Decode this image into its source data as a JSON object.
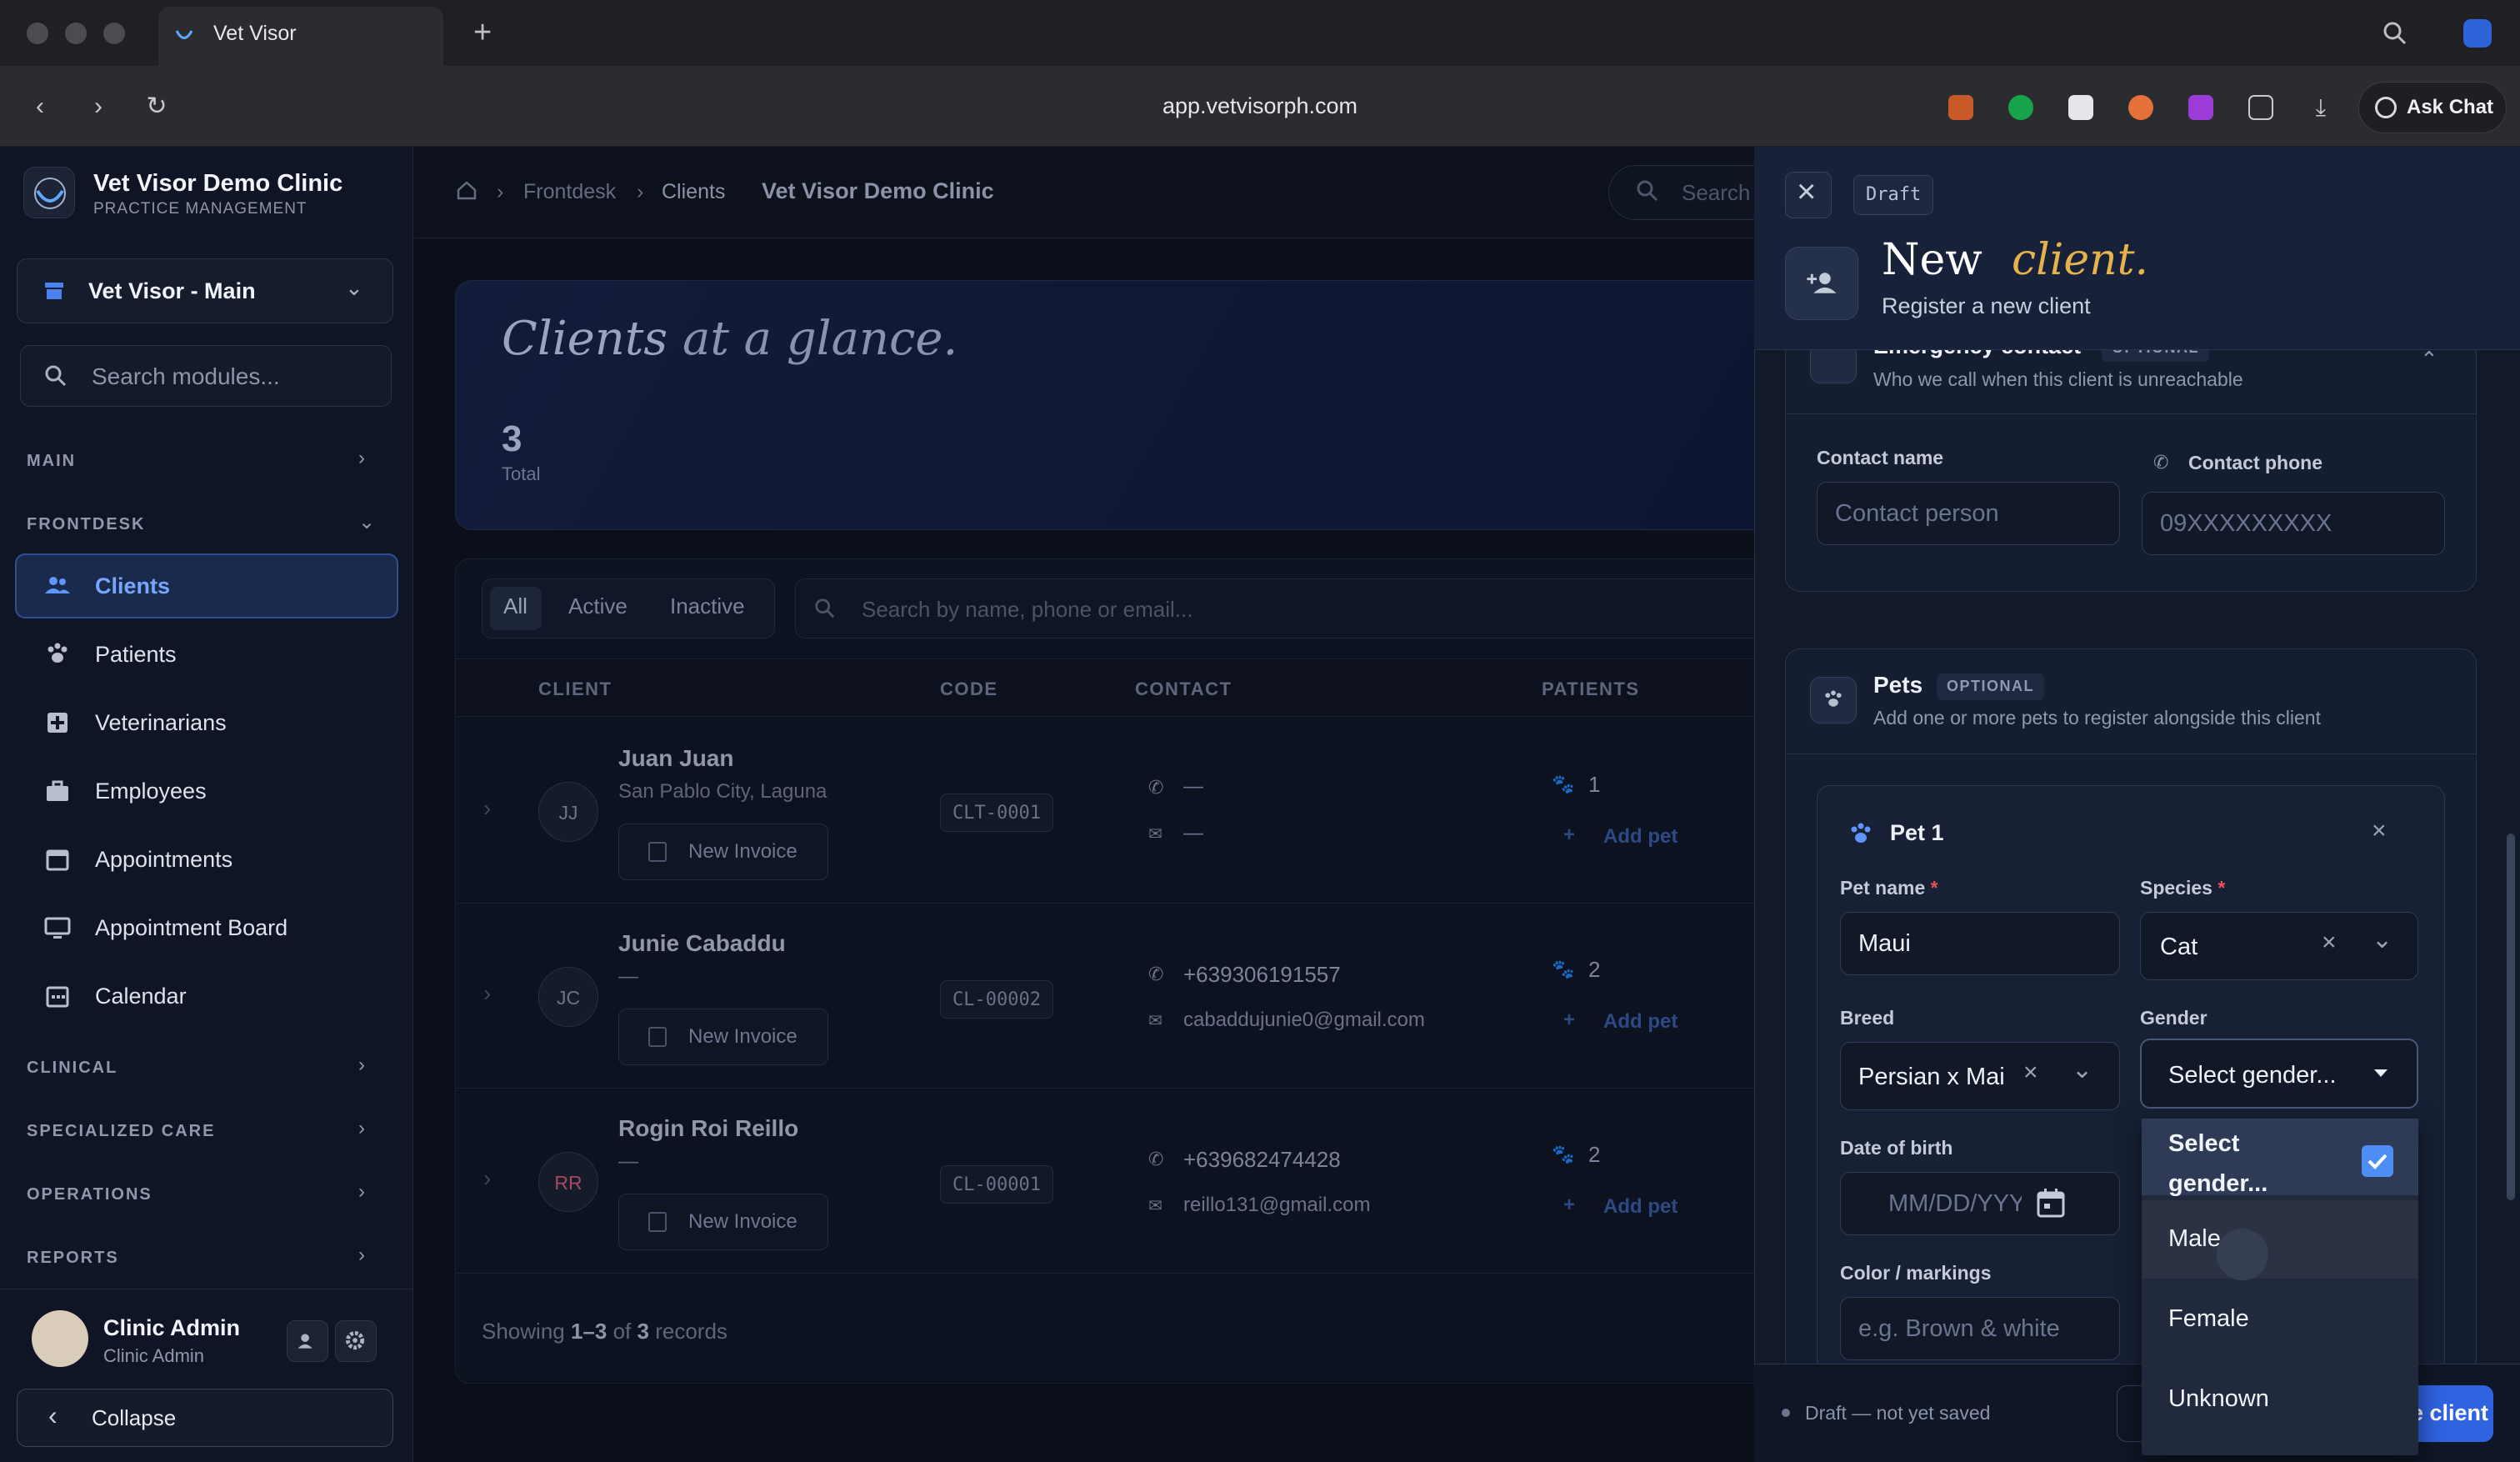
{
  "browser": {
    "tab_title": "Vet Visor",
    "url": "app.vetvisorph.com",
    "ask_chat": "Ask Chat"
  },
  "sidebar": {
    "clinic_name": "Vet Visor Demo Clinic",
    "clinic_sub": "PRACTICE MANAGEMENT",
    "branch": "Vet Visor - Main",
    "search_placeholder": "Search modules...",
    "sections": {
      "main": "MAIN",
      "frontdesk": "FRONTDESK",
      "clinical": "CLINICAL",
      "specialized": "SPECIALIZED CARE",
      "operations": "OPERATIONS",
      "reports": "REPORTS"
    },
    "items": [
      {
        "label": "Clients",
        "icon": "users-icon",
        "active": true
      },
      {
        "label": "Patients",
        "icon": "paw-icon"
      },
      {
        "label": "Veterinarians",
        "icon": "medical-plus-icon"
      },
      {
        "label": "Employees",
        "icon": "briefcase-icon"
      },
      {
        "label": "Appointments",
        "icon": "calendar-icon"
      },
      {
        "label": "Appointment Board",
        "icon": "monitor-icon"
      },
      {
        "label": "Calendar",
        "icon": "calendar-grid-icon"
      }
    ],
    "user": {
      "name": "Clinic Admin",
      "role": "Clinic Admin"
    },
    "collapse": "Collapse"
  },
  "main": {
    "breadcrumb": [
      "Frontdesk",
      "Clients",
      "Vet Visor Demo Clinic"
    ],
    "search_label": "Search",
    "hero": {
      "title_a": "Clients",
      "title_b": "at a glance.",
      "total": "3",
      "total_label": "Total"
    },
    "filters": [
      "All",
      "Active",
      "Inactive"
    ],
    "table_search_placeholder": "Search by name, phone or email...",
    "columns": [
      "CLIENT",
      "CODE",
      "CONTACT",
      "PATIENTS"
    ],
    "rows": [
      {
        "initials": "JJ",
        "name": "Juan Juan",
        "sub": "San Pablo City, Laguna",
        "code": "CLT-0001",
        "phone": "—",
        "email": "—",
        "patients": "1"
      },
      {
        "initials": "JC",
        "name": "Junie Cabaddu",
        "sub": "—",
        "code": "CL-00002",
        "phone": "+639306191557",
        "email": "cabaddujunie0@gmail.com",
        "patients": "2"
      },
      {
        "initials": "RR",
        "name": "Rogin Roi Reillo",
        "sub": "—",
        "code": "CL-00001",
        "phone": "+639682474428",
        "email": "reillo131@gmail.com",
        "patients": "2"
      }
    ],
    "new_invoice": "New Invoice",
    "add_pet": "Add pet",
    "showing": {
      "prefix": "Showing",
      "range": "1–3",
      "of": "of",
      "total": "3",
      "suffix": "records"
    }
  },
  "drawer": {
    "draft_badge": "Draft",
    "title_a": "New",
    "title_b": "client.",
    "subtitle": "Register a new client",
    "emergency": {
      "title": "Emergency contact",
      "badge": "OPTIONAL",
      "sub": "Who we call when this client is unreachable",
      "contact_name_label": "Contact name",
      "contact_name_placeholder": "Contact person",
      "contact_phone_label": "Contact phone",
      "contact_phone_placeholder": "09XXXXXXXXX"
    },
    "pets": {
      "title": "Pets",
      "badge": "OPTIONAL",
      "sub": "Add one or more pets to register alongside this client"
    },
    "pet1": {
      "title": "Pet 1",
      "name_label": "Pet name",
      "name_value": "Maui",
      "species_label": "Species",
      "species_value": "Cat",
      "breed_label": "Breed",
      "breed_value": "Persian x Mai",
      "gender_label": "Gender",
      "gender_value": "Select gender...",
      "dob_label": "Date of birth",
      "dob_placeholder": "MM/DD/YYYY",
      "color_label": "Color / markings",
      "color_placeholder": "e.g. Brown & white"
    },
    "gender_options": [
      "Select gender...",
      "Male",
      "Female",
      "Unknown"
    ],
    "gender_selected": "Select gender...",
    "footer": {
      "status": "Draft — not yet saved",
      "save": "Save client"
    }
  },
  "colors": {
    "accent": "#2f63e0",
    "gold": "#e6b24c",
    "check": "#4d8ff5"
  }
}
